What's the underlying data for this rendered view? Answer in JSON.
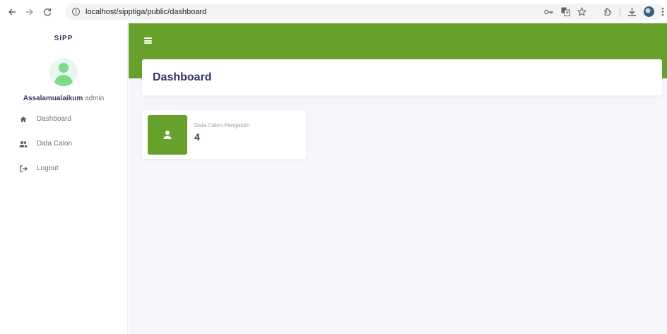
{
  "browser": {
    "url": "localhost/sipptiga/public/dashboard",
    "icons": [
      "back-icon",
      "forward-icon",
      "reload-icon",
      "site-info-icon",
      "password-key-icon",
      "translate-icon",
      "bookmark-star-icon",
      "extensions-icon",
      "download-icon",
      "profile-avatar",
      "more-menu-icon"
    ]
  },
  "sidebar": {
    "brand": "SIPP",
    "greeting_prefix": "Assalamualaikum",
    "username": "admin",
    "items": [
      {
        "label": "Dashboard",
        "icon": "home-icon"
      },
      {
        "label": "Data Calon",
        "icon": "users-icon"
      },
      {
        "label": "Logout",
        "icon": "logout-icon"
      }
    ]
  },
  "header": {
    "title": "Dashboard"
  },
  "stats": [
    {
      "label": "Data Calon Pengantin",
      "value": "4",
      "icon": "user-icon"
    }
  ],
  "colors": {
    "accent": "#67a12b",
    "background": "#f4f6f9",
    "text": "#34395e",
    "avatar": "#7ed98a"
  }
}
